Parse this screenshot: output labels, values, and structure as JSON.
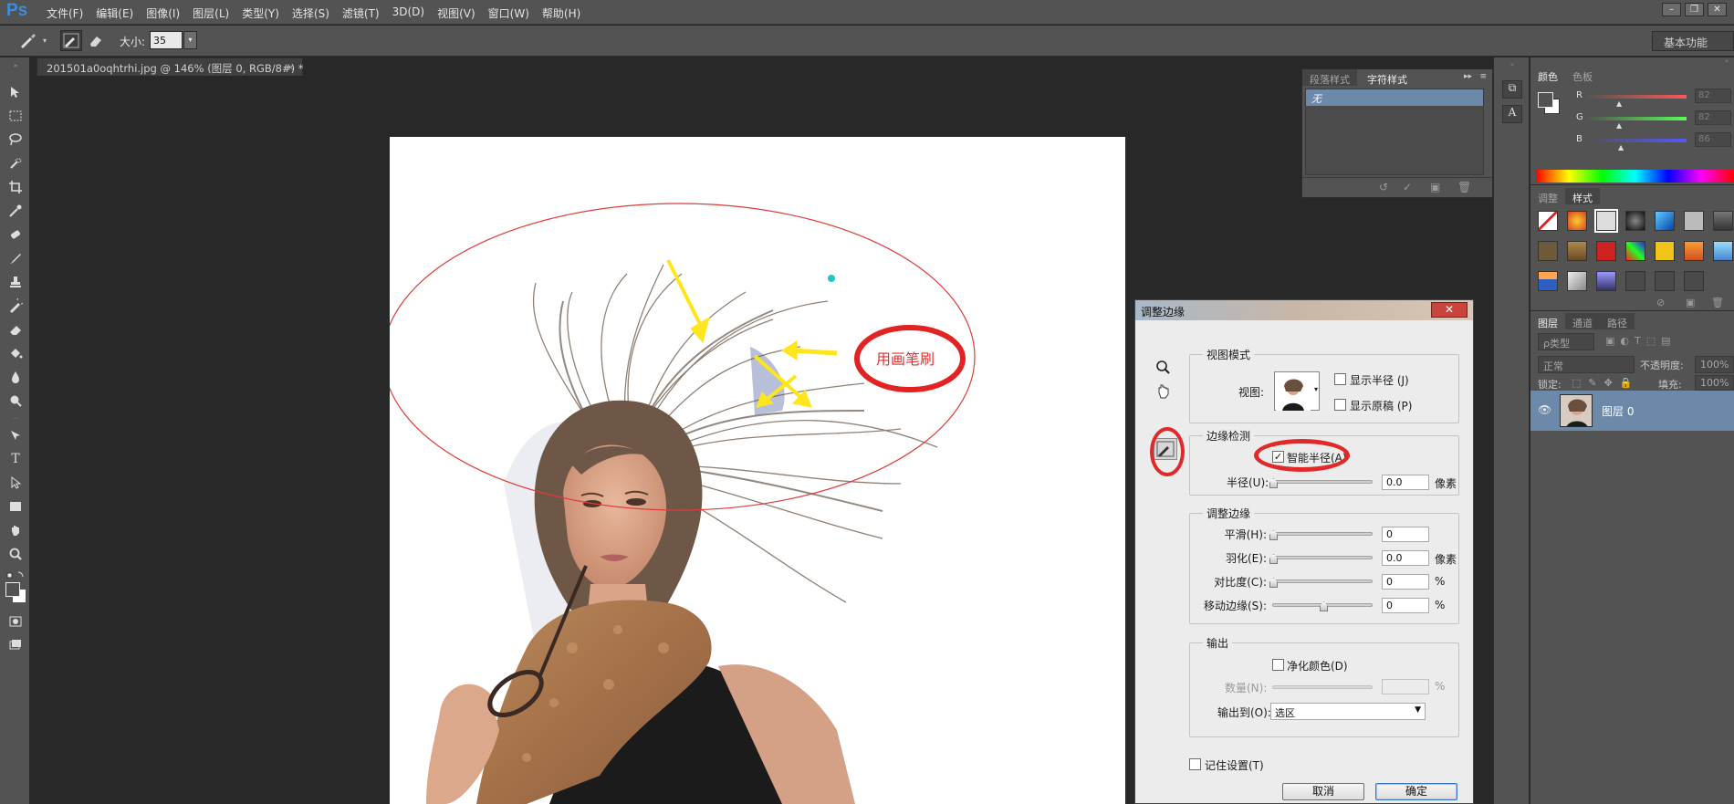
{
  "app": {
    "logo": "Ps"
  },
  "menu": [
    "文件(F)",
    "编辑(E)",
    "图像(I)",
    "图层(L)",
    "类型(Y)",
    "选择(S)",
    "滤镜(T)",
    "3D(D)",
    "视图(V)",
    "窗口(W)",
    "帮助(H)"
  ],
  "options": {
    "size_label": "大小:",
    "size_value": "35",
    "workspace": "基本功能"
  },
  "document": {
    "tab_title": "201501a0oqhtrhi.jpg @ 146% (图层 0, RGB/8#) *"
  },
  "annotation": {
    "text": "用画笔刷",
    "color": "#e03131"
  },
  "char_panel": {
    "tabs": [
      "段落样式",
      "字符样式"
    ],
    "active_tab": "字符样式",
    "items": [
      "无"
    ]
  },
  "color_panel": {
    "tabs": [
      "颜色",
      "色板"
    ],
    "sliders": [
      {
        "label": "R",
        "value": "82"
      },
      {
        "label": "G",
        "value": "82"
      },
      {
        "label": "B",
        "value": "86"
      }
    ]
  },
  "style_panel": {
    "tabs": [
      "调整",
      "样式"
    ],
    "active_tab": "样式"
  },
  "layers_panel": {
    "tabs": [
      "图层",
      "通道",
      "路径"
    ],
    "filter_kind": "ρ类型",
    "blend_mode": "正常",
    "opacity_label": "不透明度:",
    "opacity_value": "100%",
    "lock_label": "锁定:",
    "fill_label": "填充:",
    "fill_value": "100%",
    "layer_name": "图层 0"
  },
  "dialog": {
    "title": "调整边缘",
    "view_mode": {
      "title": "视图模式",
      "view_label": "视图:",
      "show_radius": "显示半径 (J)",
      "show_original": "显示原稿 (P)"
    },
    "edge_detection": {
      "title": "边缘检测",
      "smart_radius": "智能半径(A)",
      "smart_radius_checked": true,
      "radius_label": "半径(U):",
      "radius_value": "0.0",
      "radius_unit": "像素"
    },
    "adjust_edge": {
      "title": "调整边缘",
      "rows": [
        {
          "label": "平滑(H):",
          "value": "0",
          "unit": "",
          "level": 0
        },
        {
          "label": "羽化(E):",
          "value": "0.0",
          "unit": "像素",
          "level": 0
        },
        {
          "label": "对比度(C):",
          "value": "0",
          "unit": "%",
          "level": 0
        },
        {
          "label": "移动边缘(S):",
          "value": "0",
          "unit": "%",
          "level": 0.5
        }
      ]
    },
    "output": {
      "title": "输出",
      "decontaminate": "净化颜色(D)",
      "amount_label": "数量(N):",
      "amount_unit": "%",
      "output_to_label": "输出到(O):",
      "output_to_value": "选区"
    },
    "remember": "记住设置(T)",
    "cancel": "取消",
    "ok": "确定"
  }
}
